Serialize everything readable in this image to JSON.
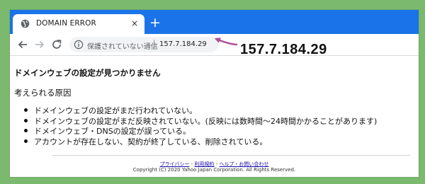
{
  "colors": {
    "background": "#7ab96e",
    "tab_bar": "#1a73e8",
    "annotation_arrow": "#b04d96"
  },
  "browser": {
    "tab_title": "DOMAIN ERROR",
    "tab_icon": "globe-icon",
    "new_tab_label": "+",
    "close_label": "×",
    "omnibox": {
      "status_text": "保護されていない通信",
      "url": "157.7.184.29"
    }
  },
  "annotation": {
    "ip_callout": "157.7.184.29"
  },
  "page": {
    "heading": "ドメインウェブの設定が見つかりません",
    "subheading": "考えられる原因",
    "reasons": [
      "ドメインウェブの設定がまだ行われていない。",
      "ドメインウェブの設定がまだ反映されていない。(反映には数時間〜24時間かかることがあります)",
      "ドメインウェブ・DNSの設定が誤っている。",
      "アカウントが存在しない、契約が終了している、削除されている。"
    ]
  },
  "footer": {
    "link_privacy": "プライバシー",
    "link_terms": "利用規約",
    "link_help": "ヘルプ・お問い合わせ",
    "separator": " - ",
    "copyright": "Copyright (C) 2020 Yahoo Japan Corporation. All Rights Reserved."
  }
}
